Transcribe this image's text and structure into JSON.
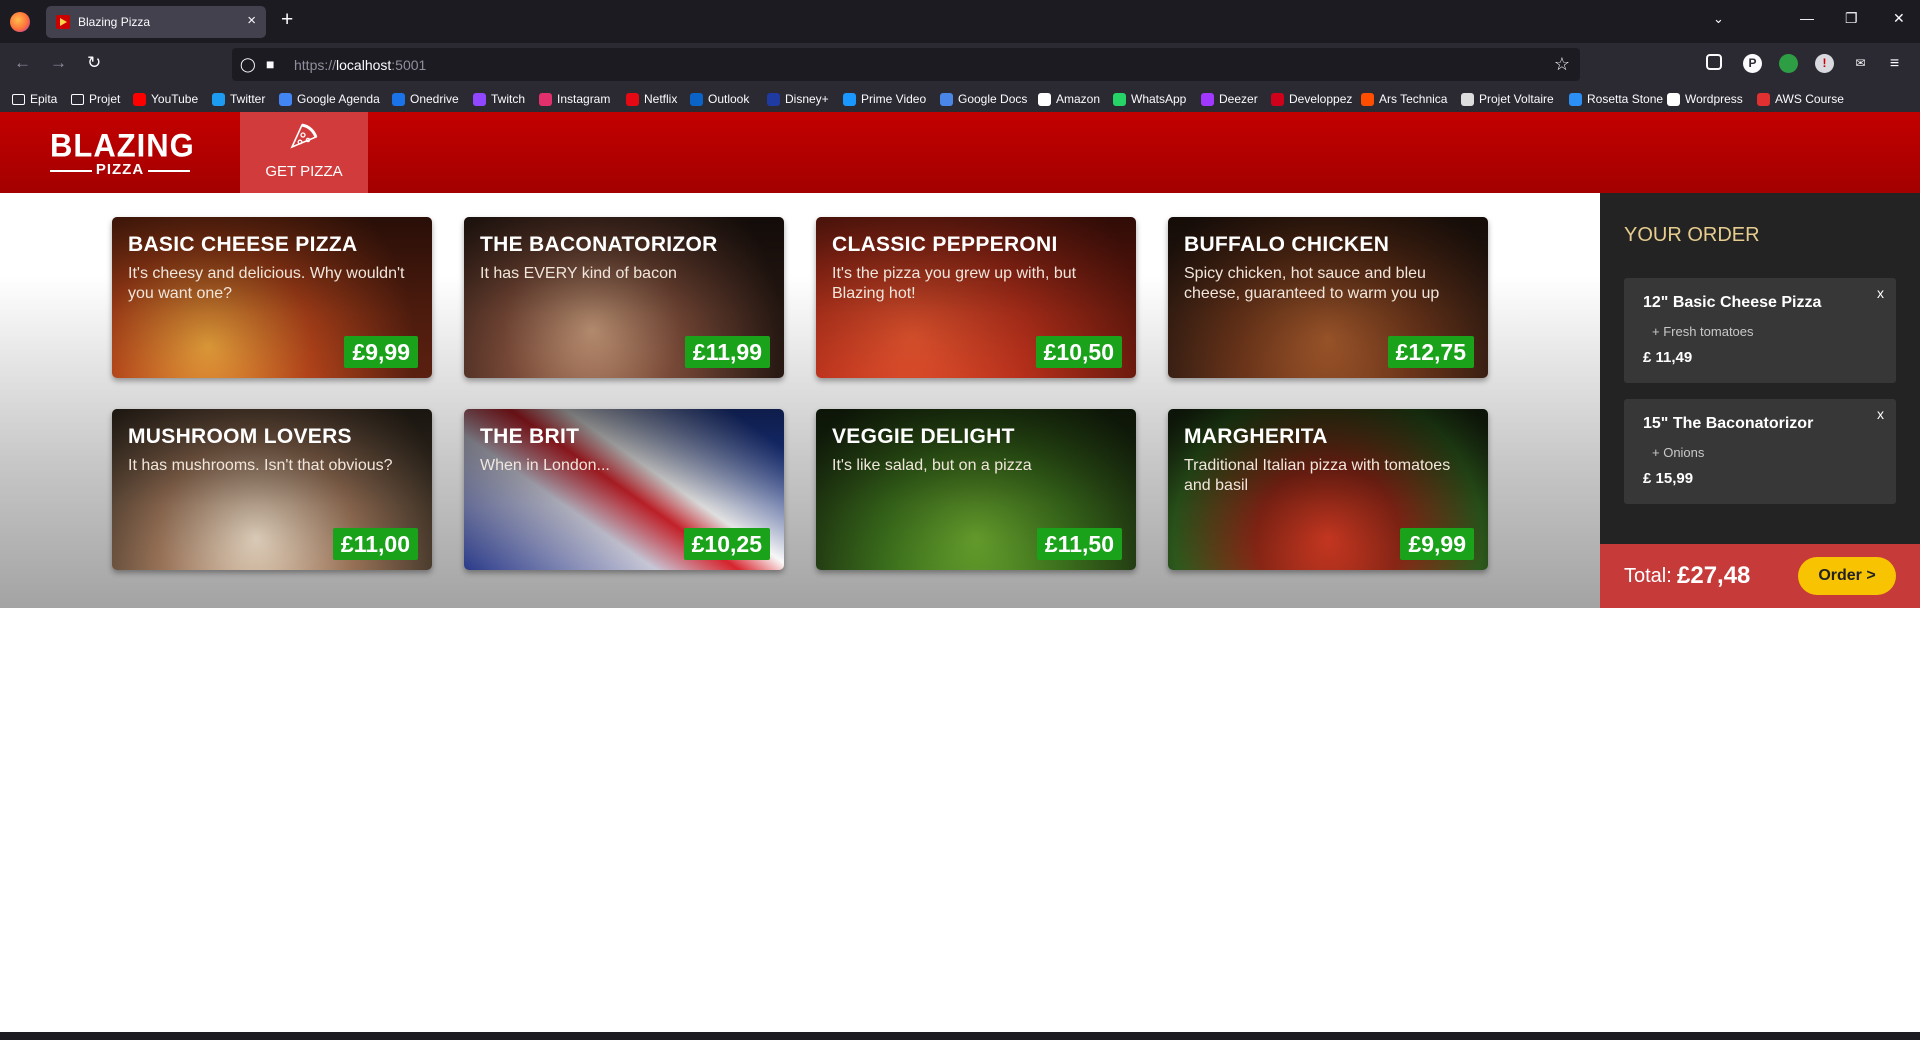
{
  "browser": {
    "tab_title": "Blazing Pizza",
    "tab_close": "×",
    "new_tab": "+",
    "url_scheme": "https://",
    "url_host": "localhost",
    "url_port": ":5001"
  },
  "bookmarks": [
    {
      "label": "Epita",
      "icon": "folder-icon",
      "color": "#fbfbfe"
    },
    {
      "label": "Projet",
      "icon": "folder-icon",
      "color": "#fbfbfe"
    },
    {
      "label": "YouTube",
      "icon": "youtube-icon",
      "color": "#ff0000"
    },
    {
      "label": "Twitter",
      "icon": "twitter-icon",
      "color": "#1d9bf0"
    },
    {
      "label": "Google Agenda",
      "icon": "calendar-icon",
      "color": "#4285f4"
    },
    {
      "label": "Onedrive",
      "icon": "cloud-icon",
      "color": "#1a73e8"
    },
    {
      "label": "Twitch",
      "icon": "twitch-icon",
      "color": "#9146ff"
    },
    {
      "label": "Instagram",
      "icon": "instagram-icon",
      "color": "#e1306c"
    },
    {
      "label": "Netflix",
      "icon": "netflix-icon",
      "color": "#e50914"
    },
    {
      "label": "Outlook",
      "icon": "outlook-icon",
      "color": "#0a64c8"
    },
    {
      "label": "Disney+",
      "icon": "disney-icon",
      "color": "#1f3aa0"
    },
    {
      "label": "Prime Video",
      "icon": "prime-icon",
      "color": "#1a98ff"
    },
    {
      "label": "Google Docs",
      "icon": "docs-icon",
      "color": "#4a86e8"
    },
    {
      "label": "Amazon",
      "icon": "amazon-icon",
      "color": "#ffffff"
    },
    {
      "label": "WhatsApp",
      "icon": "whatsapp-icon",
      "color": "#25d366"
    },
    {
      "label": "Deezer",
      "icon": "deezer-icon",
      "color": "#a238ff"
    },
    {
      "label": "Developpez",
      "icon": "developpez-icon",
      "color": "#d0021b"
    },
    {
      "label": "Ars Technica",
      "icon": "ars-icon",
      "color": "#ff4e00"
    },
    {
      "label": "Projet Voltaire",
      "icon": "voltaire-icon",
      "color": "#dddddd"
    },
    {
      "label": "Rosetta Stone",
      "icon": "rosetta-icon",
      "color": "#2b8ff5"
    },
    {
      "label": "Wordpress",
      "icon": "wordpress-icon",
      "color": "#ffffff"
    },
    {
      "label": "AWS Course",
      "icon": "aws-icon",
      "color": "#e03030"
    }
  ],
  "app": {
    "logo_title": "BLAZING",
    "logo_subtitle": "PIZZA",
    "nav_get_pizza": "GET PIZZA",
    "colors": {
      "brand_red": "#b80000",
      "price_green": "#1ba21b",
      "order_yellow": "#f8c301"
    }
  },
  "specials": [
    {
      "name": "BASIC CHEESE PIZZA",
      "description": "It's cheesy and delicious. Why wouldn't you want one?",
      "price": "£9,99",
      "image": "cheese-pizza-image"
    },
    {
      "name": "THE BACONATORIZOR",
      "description": "It has EVERY kind of bacon",
      "price": "£11,99",
      "image": "bacon-pizza-image"
    },
    {
      "name": "CLASSIC PEPPERONI",
      "description": "It's the pizza you grew up with, but Blazing hot!",
      "price": "£10,50",
      "image": "pepperoni-pizza-image"
    },
    {
      "name": "BUFFALO CHICKEN",
      "description": "Spicy chicken, hot sauce and bleu cheese, guaranteed to warm you up",
      "price": "£12,75",
      "image": "buffalo-chicken-pizza-image"
    },
    {
      "name": "MUSHROOM LOVERS",
      "description": "It has mushrooms. Isn't that obvious?",
      "price": "£11,00",
      "image": "mushroom-pizza-image"
    },
    {
      "name": "THE BRIT",
      "description": "When in London...",
      "price": "£10,25",
      "image": "union-jack-image"
    },
    {
      "name": "VEGGIE DELIGHT",
      "description": "It's like salad, but on a pizza",
      "price": "£11,50",
      "image": "veggie-pizza-image"
    },
    {
      "name": "MARGHERITA",
      "description": "Traditional Italian pizza with tomatoes and basil",
      "price": "£9,99",
      "image": "margherita-pizza-image"
    }
  ],
  "order": {
    "title": "YOUR ORDER",
    "items": [
      {
        "name": "12\" Basic Cheese Pizza",
        "topping": "+ Fresh tomatoes",
        "price": "£ 11,49",
        "remove": "x"
      },
      {
        "name": "15\" The Baconatorizor",
        "topping": "+ Onions",
        "price": "£ 15,99",
        "remove": "x"
      }
    ],
    "total_label": "Total:",
    "total_value": "£27,48",
    "order_button": "Order >"
  }
}
